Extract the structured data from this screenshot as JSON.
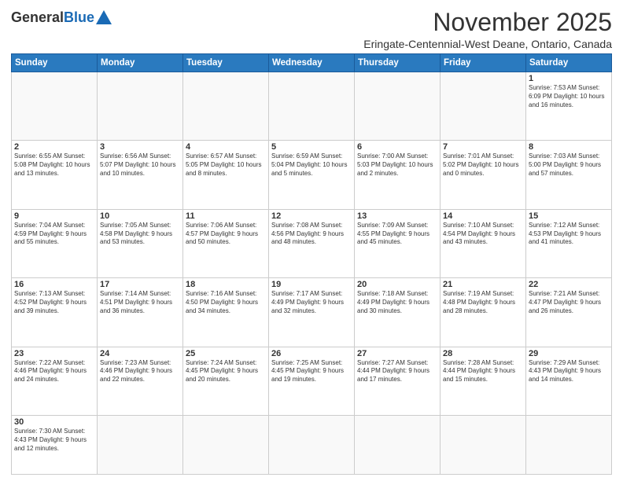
{
  "logo": {
    "general": "General",
    "blue": "Blue"
  },
  "title": "November 2025",
  "subtitle": "Eringate-Centennial-West Deane, Ontario, Canada",
  "days_of_week": [
    "Sunday",
    "Monday",
    "Tuesday",
    "Wednesday",
    "Thursday",
    "Friday",
    "Saturday"
  ],
  "weeks": [
    [
      {
        "day": "",
        "info": ""
      },
      {
        "day": "",
        "info": ""
      },
      {
        "day": "",
        "info": ""
      },
      {
        "day": "",
        "info": ""
      },
      {
        "day": "",
        "info": ""
      },
      {
        "day": "",
        "info": ""
      },
      {
        "day": "1",
        "info": "Sunrise: 7:53 AM\nSunset: 6:09 PM\nDaylight: 10 hours and 16 minutes."
      }
    ],
    [
      {
        "day": "2",
        "info": "Sunrise: 6:55 AM\nSunset: 5:08 PM\nDaylight: 10 hours and 13 minutes."
      },
      {
        "day": "3",
        "info": "Sunrise: 6:56 AM\nSunset: 5:07 PM\nDaylight: 10 hours and 10 minutes."
      },
      {
        "day": "4",
        "info": "Sunrise: 6:57 AM\nSunset: 5:05 PM\nDaylight: 10 hours and 8 minutes."
      },
      {
        "day": "5",
        "info": "Sunrise: 6:59 AM\nSunset: 5:04 PM\nDaylight: 10 hours and 5 minutes."
      },
      {
        "day": "6",
        "info": "Sunrise: 7:00 AM\nSunset: 5:03 PM\nDaylight: 10 hours and 2 minutes."
      },
      {
        "day": "7",
        "info": "Sunrise: 7:01 AM\nSunset: 5:02 PM\nDaylight: 10 hours and 0 minutes."
      },
      {
        "day": "8",
        "info": "Sunrise: 7:03 AM\nSunset: 5:00 PM\nDaylight: 9 hours and 57 minutes."
      }
    ],
    [
      {
        "day": "9",
        "info": "Sunrise: 7:04 AM\nSunset: 4:59 PM\nDaylight: 9 hours and 55 minutes."
      },
      {
        "day": "10",
        "info": "Sunrise: 7:05 AM\nSunset: 4:58 PM\nDaylight: 9 hours and 53 minutes."
      },
      {
        "day": "11",
        "info": "Sunrise: 7:06 AM\nSunset: 4:57 PM\nDaylight: 9 hours and 50 minutes."
      },
      {
        "day": "12",
        "info": "Sunrise: 7:08 AM\nSunset: 4:56 PM\nDaylight: 9 hours and 48 minutes."
      },
      {
        "day": "13",
        "info": "Sunrise: 7:09 AM\nSunset: 4:55 PM\nDaylight: 9 hours and 45 minutes."
      },
      {
        "day": "14",
        "info": "Sunrise: 7:10 AM\nSunset: 4:54 PM\nDaylight: 9 hours and 43 minutes."
      },
      {
        "day": "15",
        "info": "Sunrise: 7:12 AM\nSunset: 4:53 PM\nDaylight: 9 hours and 41 minutes."
      }
    ],
    [
      {
        "day": "16",
        "info": "Sunrise: 7:13 AM\nSunset: 4:52 PM\nDaylight: 9 hours and 39 minutes."
      },
      {
        "day": "17",
        "info": "Sunrise: 7:14 AM\nSunset: 4:51 PM\nDaylight: 9 hours and 36 minutes."
      },
      {
        "day": "18",
        "info": "Sunrise: 7:16 AM\nSunset: 4:50 PM\nDaylight: 9 hours and 34 minutes."
      },
      {
        "day": "19",
        "info": "Sunrise: 7:17 AM\nSunset: 4:49 PM\nDaylight: 9 hours and 32 minutes."
      },
      {
        "day": "20",
        "info": "Sunrise: 7:18 AM\nSunset: 4:49 PM\nDaylight: 9 hours and 30 minutes."
      },
      {
        "day": "21",
        "info": "Sunrise: 7:19 AM\nSunset: 4:48 PM\nDaylight: 9 hours and 28 minutes."
      },
      {
        "day": "22",
        "info": "Sunrise: 7:21 AM\nSunset: 4:47 PM\nDaylight: 9 hours and 26 minutes."
      }
    ],
    [
      {
        "day": "23",
        "info": "Sunrise: 7:22 AM\nSunset: 4:46 PM\nDaylight: 9 hours and 24 minutes."
      },
      {
        "day": "24",
        "info": "Sunrise: 7:23 AM\nSunset: 4:46 PM\nDaylight: 9 hours and 22 minutes."
      },
      {
        "day": "25",
        "info": "Sunrise: 7:24 AM\nSunset: 4:45 PM\nDaylight: 9 hours and 20 minutes."
      },
      {
        "day": "26",
        "info": "Sunrise: 7:25 AM\nSunset: 4:45 PM\nDaylight: 9 hours and 19 minutes."
      },
      {
        "day": "27",
        "info": "Sunrise: 7:27 AM\nSunset: 4:44 PM\nDaylight: 9 hours and 17 minutes."
      },
      {
        "day": "28",
        "info": "Sunrise: 7:28 AM\nSunset: 4:44 PM\nDaylight: 9 hours and 15 minutes."
      },
      {
        "day": "29",
        "info": "Sunrise: 7:29 AM\nSunset: 4:43 PM\nDaylight: 9 hours and 14 minutes."
      }
    ],
    [
      {
        "day": "30",
        "info": "Sunrise: 7:30 AM\nSunset: 4:43 PM\nDaylight: 9 hours and 12 minutes."
      },
      {
        "day": "",
        "info": ""
      },
      {
        "day": "",
        "info": ""
      },
      {
        "day": "",
        "info": ""
      },
      {
        "day": "",
        "info": ""
      },
      {
        "day": "",
        "info": ""
      },
      {
        "day": "",
        "info": ""
      }
    ]
  ]
}
